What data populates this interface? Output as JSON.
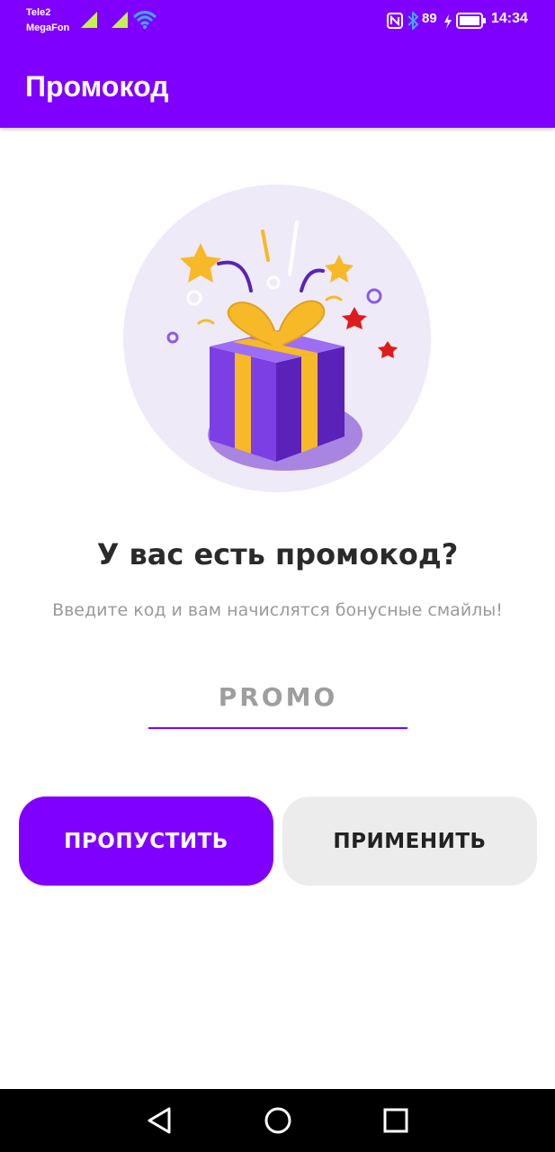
{
  "status_bar": {
    "carrier1": "Tele2",
    "carrier2": "MegaFon",
    "battery_level": "89",
    "time": "14:34",
    "icons": [
      "signal-icon",
      "signal-icon",
      "wifi-icon",
      "nfc-icon",
      "bluetooth-icon",
      "charging-icon",
      "battery-icon"
    ]
  },
  "app_bar": {
    "title": "Промокод"
  },
  "main": {
    "headline": "У вас есть промокод?",
    "subtitle": "Введите код и вам начислятся бонусные смайлы!",
    "promo_input": {
      "placeholder": "PROMO",
      "value": ""
    },
    "skip_label": "ПРОПУСТИТЬ",
    "apply_label": "ПРИМЕНИТЬ"
  },
  "nav_bar": {
    "icons": [
      "back-icon",
      "home-icon",
      "recent-apps-icon"
    ]
  },
  "colors": {
    "accent": "#8000ff",
    "gift_purple": "#7b3fe4",
    "ribbon": "#f7b928",
    "circle_bg": "#efeaf8"
  }
}
